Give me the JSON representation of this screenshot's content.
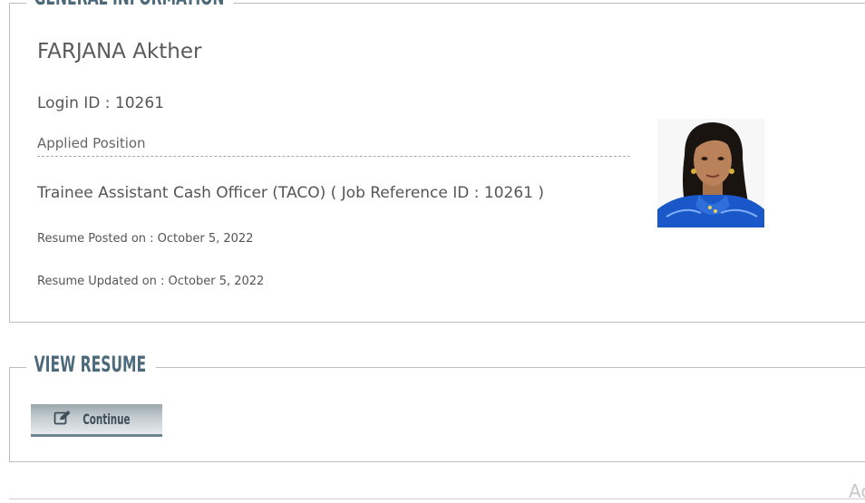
{
  "general_information": {
    "legend": "GENERAL INFORMATION",
    "name": "FARJANA Akther",
    "login_id": "Login ID : 10261",
    "applied_position_label": "Applied Position",
    "position": "Trainee Assistant Cash Officer (TACO) ( Job Reference ID : 10261 )",
    "resume_posted": "Resume Posted on : October 5, 2022",
    "resume_updated": "Resume Updated on : October 5, 2022"
  },
  "view_resume": {
    "legend": "VIEW RESUME",
    "continue_button": {
      "label": "Continue",
      "icon": "edit-icon"
    }
  },
  "corner_text": "Ac",
  "colors": {
    "legend": "#4d6a7a",
    "body_text": "#555555",
    "border": "#bdbdbd",
    "button_accent": "#6e8491",
    "photo_background_blue": "#1a57c9"
  }
}
